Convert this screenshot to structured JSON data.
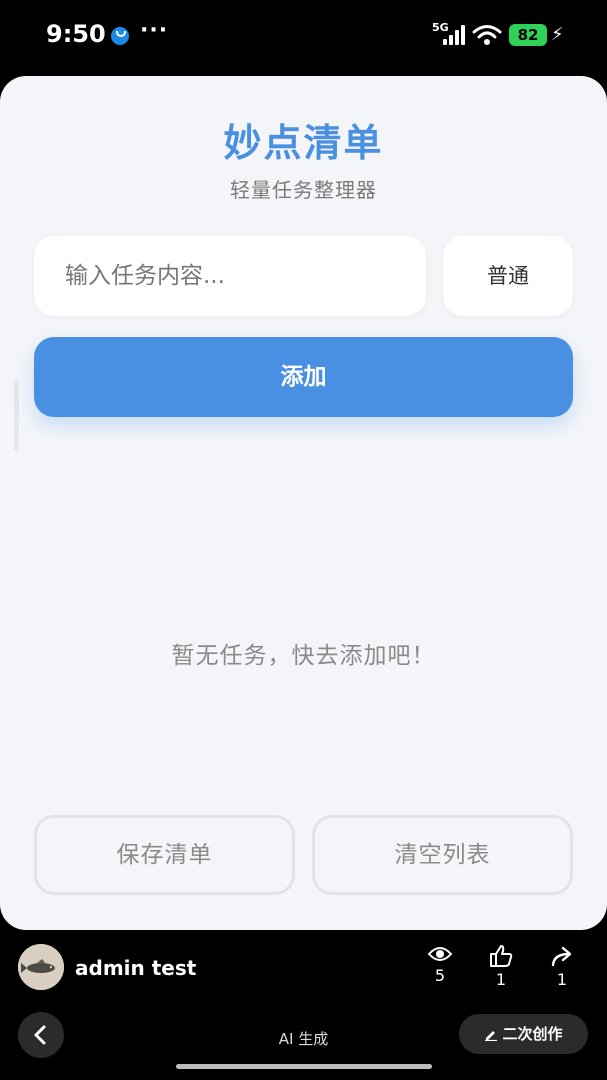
{
  "status_bar": {
    "time": "9:50",
    "more": "···",
    "network": "5G",
    "battery": "82"
  },
  "app": {
    "title": "妙点清单",
    "subtitle": "轻量任务整理器",
    "task_input_placeholder": "输入任务内容...",
    "task_input_value": "",
    "priority_selected": "普通",
    "add_label": "添加",
    "empty_message": "暂无任务，快去添加吧！",
    "save_label": "保存清单",
    "clear_label": "清空列表",
    "accent_color": "#4a90e2"
  },
  "author": {
    "name": "admin test",
    "avatar_icon": "fish-painting-avatar"
  },
  "stats": {
    "views": "5",
    "likes": "1",
    "shares": "1"
  },
  "bottom_bar": {
    "ai_label": "AI 生成",
    "remix_label": "二次创作"
  }
}
